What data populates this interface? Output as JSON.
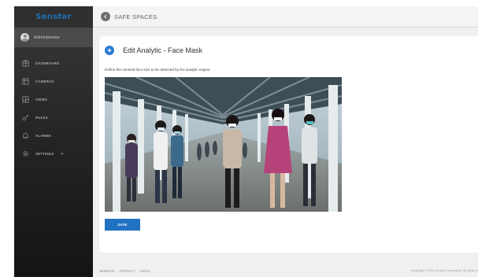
{
  "app": {
    "logo_text": "Senstar",
    "brand_title": "SAFE SPACES"
  },
  "user": {
    "name": "Administrator"
  },
  "sidebar": {
    "items": [
      {
        "label": "DASHBOARD",
        "icon": "building-icon"
      },
      {
        "label": "CAMERAS",
        "icon": "camera-grid-icon"
      },
      {
        "label": "VIEWS",
        "icon": "views-icon"
      },
      {
        "label": "RULES",
        "icon": "rules-icon"
      },
      {
        "label": "ALARMS",
        "icon": "bell-icon"
      },
      {
        "label": "SETTINGS",
        "icon": "gear-icon",
        "chevron": "▾"
      }
    ]
  },
  "page": {
    "title": "Edit Analytic - Face Mask",
    "description": "Define the minimal face size to be detected by the analytic engine.",
    "image_alt": "camera-snapshot-pedestrian-walkway",
    "save_label": "SAVE"
  },
  "footer": {
    "links": [
      "SENSTAR",
      "CONTACT",
      "LEGAL"
    ],
    "copyright": "Copyright © 2020 Senstar Corporation. All rights re"
  },
  "colors": {
    "accent": "#2272c3",
    "logo": "#1f6fb8",
    "sidebar_bg": "#262626"
  }
}
